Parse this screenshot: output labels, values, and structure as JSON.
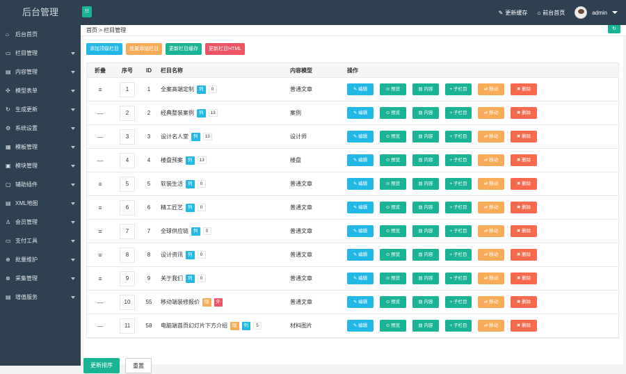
{
  "brand": "后台管理",
  "toggle_icon": "☷",
  "topnav": {
    "update": "更新缓存",
    "home": "前台首页",
    "user": "admin"
  },
  "sidebar": [
    {
      "icon": "⌂",
      "label": "后台首页",
      "arrow": false
    },
    {
      "icon": "▭",
      "label": "栏目管理",
      "arrow": true
    },
    {
      "icon": "▤",
      "label": "内容管理",
      "arrow": true
    },
    {
      "icon": "✣",
      "label": "模型表单",
      "arrow": true
    },
    {
      "icon": "↻",
      "label": "生成更新",
      "arrow": true
    },
    {
      "icon": "⚙",
      "label": "系统设置",
      "arrow": true
    },
    {
      "icon": "▦",
      "label": "模板管理",
      "arrow": true
    },
    {
      "icon": "▣",
      "label": "模块管理",
      "arrow": true
    },
    {
      "icon": "▢",
      "label": "辅助插件",
      "arrow": true
    },
    {
      "icon": "▤",
      "label": "XML地图",
      "arrow": true
    },
    {
      "icon": "♙",
      "label": "会员管理",
      "arrow": true
    },
    {
      "icon": "▭",
      "label": "支付工具",
      "arrow": true
    },
    {
      "icon": "⊕",
      "label": "批量维护",
      "arrow": true
    },
    {
      "icon": "⊗",
      "label": "采集管理",
      "arrow": true
    },
    {
      "icon": "▤",
      "label": "增值服务",
      "arrow": true
    }
  ],
  "breadcrumb": "首页 > 栏目管理",
  "refresh_icon": "↻",
  "toolbar": {
    "add_top": "添加顶级栏目",
    "batch_add": "批量添加栏目",
    "update_cache": "更新栏目缓存",
    "update_html": "更新栏目HTML"
  },
  "columns": {
    "fold": "折叠",
    "sort": "序号",
    "id": "ID",
    "name": "栏目名称",
    "model": "内容模型",
    "ops": "操作"
  },
  "ops": {
    "edit": "编辑",
    "browse": "预览",
    "content": "内容",
    "sub": "子栏目",
    "move": "移动",
    "del": "删除"
  },
  "rows": [
    {
      "fold": "≡",
      "sort": "1",
      "id": "1",
      "name": "全案高端定制",
      "tags": [
        "列"
      ],
      "count": "0",
      "model": "普通文章"
    },
    {
      "fold": "—",
      "sort": "2",
      "id": "2",
      "name": "经典整装案例",
      "tags": [
        "列"
      ],
      "count": "13",
      "model": "案例"
    },
    {
      "fold": "—",
      "sort": "3",
      "id": "3",
      "name": "设计名人堂",
      "tags": [
        "列"
      ],
      "count": "13",
      "model": "设计师"
    },
    {
      "fold": "—",
      "sort": "4",
      "id": "4",
      "name": "楼盘预案",
      "tags": [
        "列"
      ],
      "count": "13",
      "model": "楼盘"
    },
    {
      "fold": "≡",
      "sort": "5",
      "id": "5",
      "name": "软装生活",
      "tags": [
        "列"
      ],
      "count": "0",
      "model": "普通文章"
    },
    {
      "fold": "≡",
      "sort": "6",
      "id": "6",
      "name": "精工匠艺",
      "tags": [
        "列"
      ],
      "count": "0",
      "model": "普通文章"
    },
    {
      "fold": "≡",
      "sort": "7",
      "id": "7",
      "name": "全球供应链",
      "tags": [
        "列"
      ],
      "count": "0",
      "model": "普通文章"
    },
    {
      "fold": "≡",
      "sort": "8",
      "id": "8",
      "name": "设计资讯",
      "tags": [
        "列"
      ],
      "count": "0",
      "model": "普通文章"
    },
    {
      "fold": "≡",
      "sort": "9",
      "id": "9",
      "name": "关于我们",
      "tags": [
        "列"
      ],
      "count": "0",
      "model": "普通文章"
    },
    {
      "fold": "—",
      "sort": "10",
      "id": "55",
      "name": "移动端装修报价",
      "tags": [
        "隐",
        "外"
      ],
      "count": "",
      "model": "普通文章"
    },
    {
      "fold": "—",
      "sort": "11",
      "id": "58",
      "name": "电脑端首页幻灯片下方介绍",
      "tags": [
        "隐",
        "列"
      ],
      "count": "5",
      "model": "材料图片"
    }
  ],
  "bottom": {
    "update_sort": "更新排序",
    "reset": "重置"
  },
  "colors": {
    "sidebar": "#2f4050",
    "green": "#1ab394",
    "blue": "#23b7e5",
    "yellow": "#f8ac59",
    "red": "#f7694f"
  }
}
